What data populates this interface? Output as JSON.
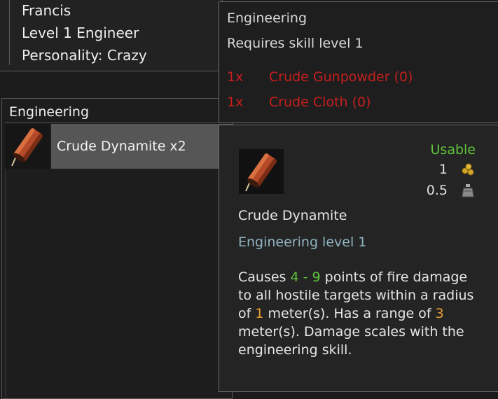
{
  "character": {
    "name": "Francis",
    "level_title": "Level 1 Engineer",
    "personality": "Personality: Crazy"
  },
  "engineering_panel": {
    "title": "Engineering",
    "recipes": [
      {
        "label": "Crude Dynamite x2",
        "icon": "dynamite-icon",
        "selected": true
      }
    ]
  },
  "requirements": {
    "title": "Engineering",
    "level_text": "Requires skill level 1",
    "color_missing": "#c81e1e",
    "items": [
      {
        "qty": "1x",
        "name": "Crude Gunpowder (0)"
      },
      {
        "qty": "1x",
        "name": "Crude Cloth (0)"
      }
    ]
  },
  "item": {
    "name": "Crude Dynamite",
    "icon": "dynamite-icon",
    "status": "Usable",
    "status_color": "#5fc23a",
    "stack_value": "1",
    "stack_icon": "coins-icon",
    "weight_value": "0.5",
    "weight_icon": "weight-icon",
    "requirement": "Engineering level 1",
    "description": {
      "t1": "Causes ",
      "damage_range": "4 - 9",
      "t2": " points of fire damage to all hostile targets within a radius of ",
      "radius": "1",
      "t3": " meter(s). Has a range of ",
      "range": "3",
      "t4": " meter(s). Damage scales with the engineering skill."
    }
  }
}
